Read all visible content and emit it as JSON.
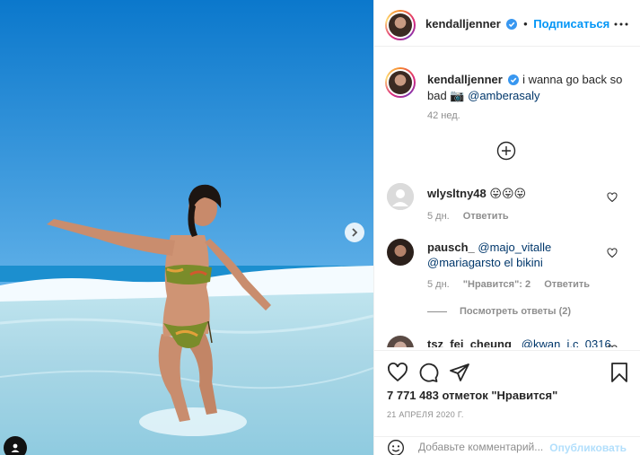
{
  "post": {
    "author": "kendalljenner",
    "follow_label": "Подписаться",
    "more_icon": "more-horizontal-icon",
    "verified_icon": "verified-badge-icon"
  },
  "caption": {
    "author": "kendalljenner",
    "text": "i wanna go back so bad 📷",
    "mention": "@amberasaly",
    "age": "42 нед."
  },
  "load_more_icon": "plus-circle-icon",
  "comments": [
    {
      "user": "wlysltny48",
      "text": "😛😛😛",
      "age": "5 дн.",
      "reply": "Ответить",
      "likes": ""
    },
    {
      "user": "pausch_",
      "text": "@majo_vitalle @mariagarsto el bikini",
      "age": "5 дн.",
      "likes": "\"Нравится\": 2",
      "reply": "Ответить",
      "view_replies": "Посмотреть ответы (2)"
    },
    {
      "user": "tsz_fei_cheung_",
      "text": "@kwan_j.c_0316",
      "age": "",
      "reply": "",
      "likes": ""
    }
  ],
  "actions": {
    "like_icon": "heart-icon",
    "comment_icon": "comment-icon",
    "share_icon": "paper-plane-icon",
    "save_icon": "bookmark-icon",
    "likes_text": "7 771 483 отметок \"Нравится\"",
    "date": "21 АПРЕЛЯ 2020 Г."
  },
  "add_comment": {
    "emoji_icon": "smile-icon",
    "placeholder": "Добавьте комментарий...",
    "publish_label": "Опубликовать"
  },
  "colors": {
    "accent": "#0095f6",
    "text": "#262626",
    "muted": "#8e8e8e",
    "border": "#efefef"
  }
}
